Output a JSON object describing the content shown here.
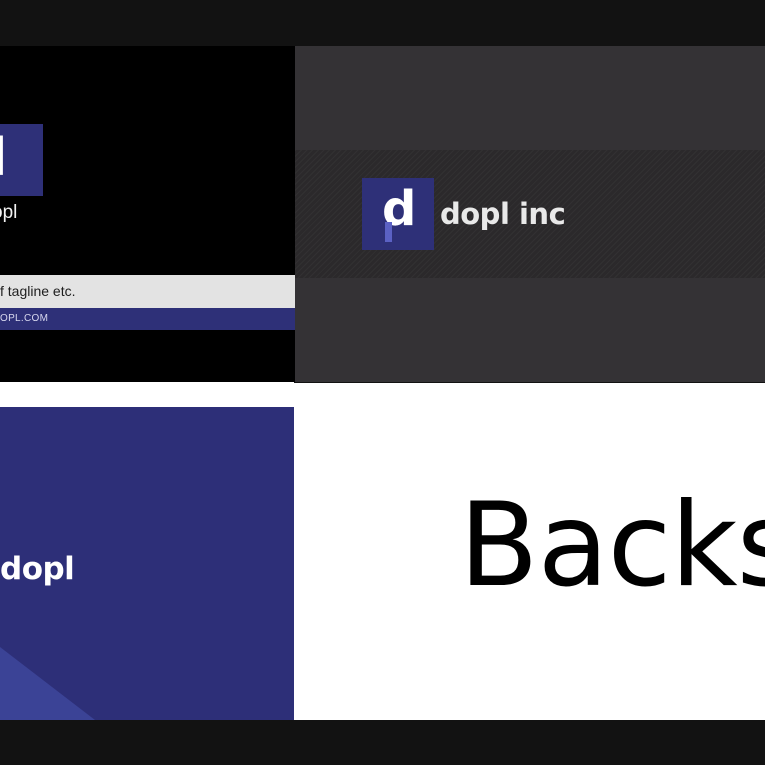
{
  "card_top_left": {
    "logo_letter": "d",
    "brand": "opl",
    "tagline": "f tagline etc.",
    "url": "OPL.COM"
  },
  "card_top_right": {
    "logo_letter": "d",
    "brand": "dopl inc"
  },
  "card_bottom_left": {
    "brand": "dopl"
  },
  "panel_bottom_right": {
    "heading": "Backs"
  },
  "colors": {
    "brand_navy": "#2e3078",
    "dark_gray": "#343235",
    "background": "#121212",
    "tagline_band": "#e3e3e3"
  }
}
